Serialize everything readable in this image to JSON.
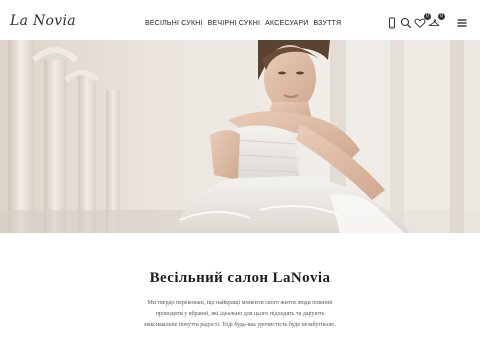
{
  "header": {
    "logo_text": "La Novia",
    "nav": [
      {
        "label": "ВЕСІЛЬНІ СУКНІ"
      },
      {
        "label": "ВЕЧІРНІ СУКНІ"
      },
      {
        "label": "АКСЕСУАРИ"
      },
      {
        "label": "ВЗУТТЯ"
      }
    ],
    "icons": {
      "phone": "phone-icon",
      "search": "search-icon",
      "wishlist": "heart-icon",
      "cart": "hanger-icon",
      "menu": "menu-icon"
    },
    "wishlist_count": "0",
    "cart_count": "0"
  },
  "hero": {
    "image": "bride-in-white-gown-seated"
  },
  "intro": {
    "title": "Весільний салон LaNovia",
    "text": "Ми твердо переконані, що найкращі моменти свого життя люди повинні проводити у вбранні, які ідеально для цього підходять та дарують максимальне почуття радості. Тоді будь-яка урочистість буде незабутньою."
  }
}
